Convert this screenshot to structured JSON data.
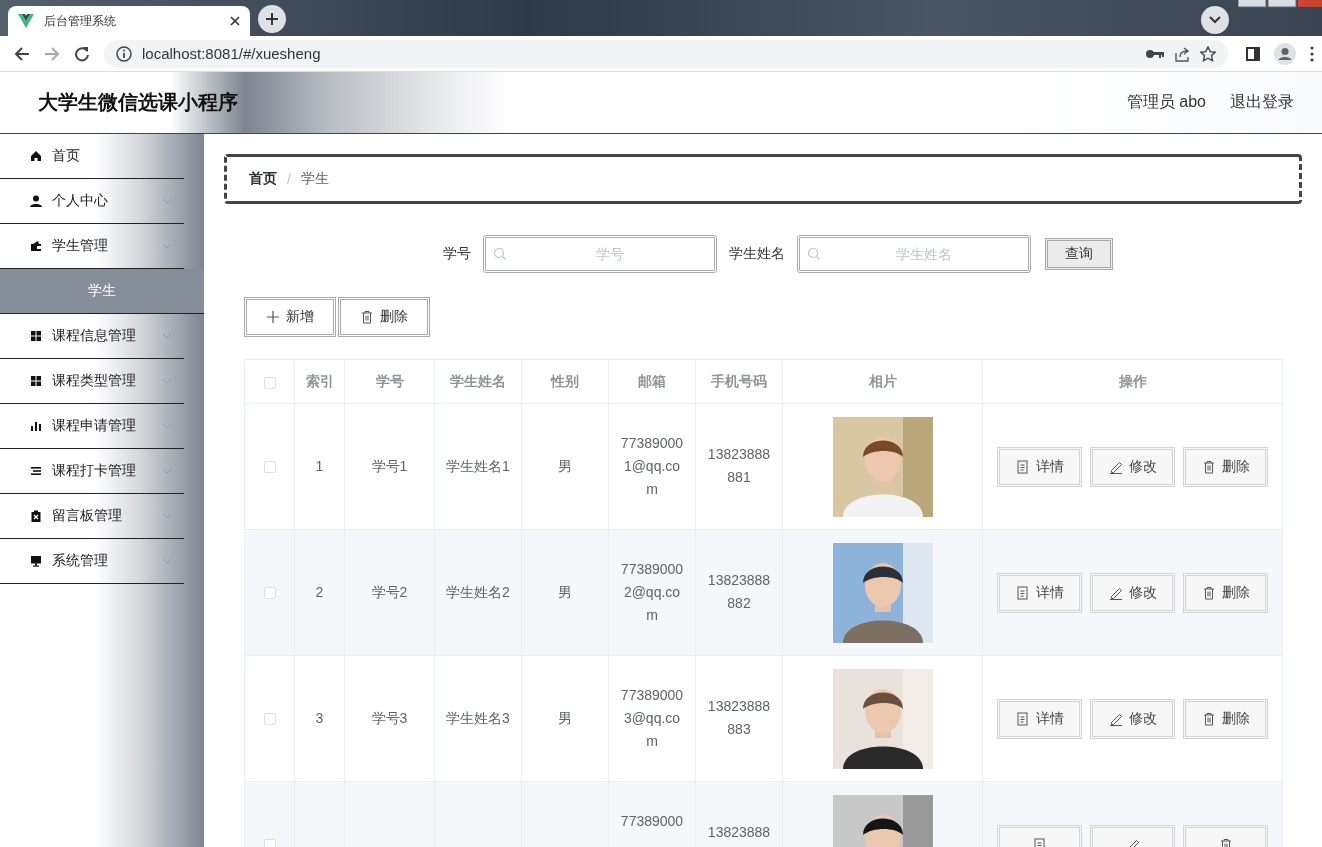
{
  "browser": {
    "tab_title": "后台管理系统",
    "url": "localhost:8081/#/xuesheng"
  },
  "header": {
    "title": "大学生微信选课小程序",
    "user": "管理员 abo",
    "logout": "退出登录"
  },
  "sidebar": {
    "items": [
      {
        "label": "首页",
        "kind": "home",
        "submenu": false
      },
      {
        "label": "个人中心",
        "kind": "user",
        "submenu": true
      },
      {
        "label": "学生管理",
        "kind": "wallet",
        "submenu": true,
        "expanded": true,
        "children": [
          {
            "label": "学生",
            "selected": true
          }
        ]
      },
      {
        "label": "课程信息管理",
        "kind": "grid",
        "submenu": true
      },
      {
        "label": "课程类型管理",
        "kind": "grid",
        "submenu": true
      },
      {
        "label": "课程申请管理",
        "kind": "chart",
        "submenu": true
      },
      {
        "label": "课程打卡管理",
        "kind": "list",
        "submenu": true
      },
      {
        "label": "留言板管理",
        "kind": "clipboard",
        "submenu": true
      },
      {
        "label": "系统管理",
        "kind": "monitor",
        "submenu": true
      }
    ]
  },
  "breadcrumb": {
    "items": [
      "首页",
      "学生"
    ],
    "separator": "/"
  },
  "search": {
    "fields": [
      {
        "label": "学号",
        "placeholder": "学号"
      },
      {
        "label": "学生姓名",
        "placeholder": "学生姓名"
      }
    ],
    "button": "查询"
  },
  "actions": [
    {
      "kind": "add",
      "label": "新增"
    },
    {
      "kind": "delete",
      "label": "删除"
    }
  ],
  "table": {
    "select_all": false,
    "columns": [
      "索引",
      "学号",
      "学生姓名",
      "性别",
      "邮箱",
      "手机号码",
      "相片",
      "操作"
    ],
    "rows": [
      {
        "checked": false,
        "index": "1",
        "xuehao": "学号1",
        "name": "学生姓名1",
        "gender": "男",
        "email": "773890001@qq.com",
        "phone": "13823888881",
        "photo": {
          "kind": "picture"
        },
        "buttons": [
          {
            "kind": "detail",
            "label": "详情"
          },
          {
            "kind": "edit",
            "label": "修改"
          },
          {
            "kind": "delete",
            "label": "删除"
          }
        ]
      },
      {
        "checked": false,
        "index": "2",
        "xuehao": "学号2",
        "name": "学生姓名2",
        "gender": "男",
        "email": "773890002@qq.com",
        "phone": "13823888882",
        "photo": {
          "kind": "picture"
        },
        "buttons": [
          {
            "kind": "detail",
            "label": "详情"
          },
          {
            "kind": "edit",
            "label": "修改"
          },
          {
            "kind": "delete",
            "label": "删除"
          }
        ]
      },
      {
        "checked": false,
        "index": "3",
        "xuehao": "学号3",
        "name": "学生姓名3",
        "gender": "男",
        "email": "773890003@qq.com",
        "phone": "13823888883",
        "photo": {
          "kind": "picture"
        },
        "buttons": [
          {
            "kind": "detail",
            "label": "详情"
          },
          {
            "kind": "edit",
            "label": "修改"
          },
          {
            "kind": "delete",
            "label": "删除"
          }
        ]
      },
      {
        "checked": false,
        "email": "77389000",
        "phone": "13823888",
        "photo": {
          "kind": "picture"
        },
        "buttons": [
          {
            "kind": "detail"
          },
          {
            "kind": "edit"
          },
          {
            "kind": "delete"
          }
        ]
      }
    ]
  }
}
